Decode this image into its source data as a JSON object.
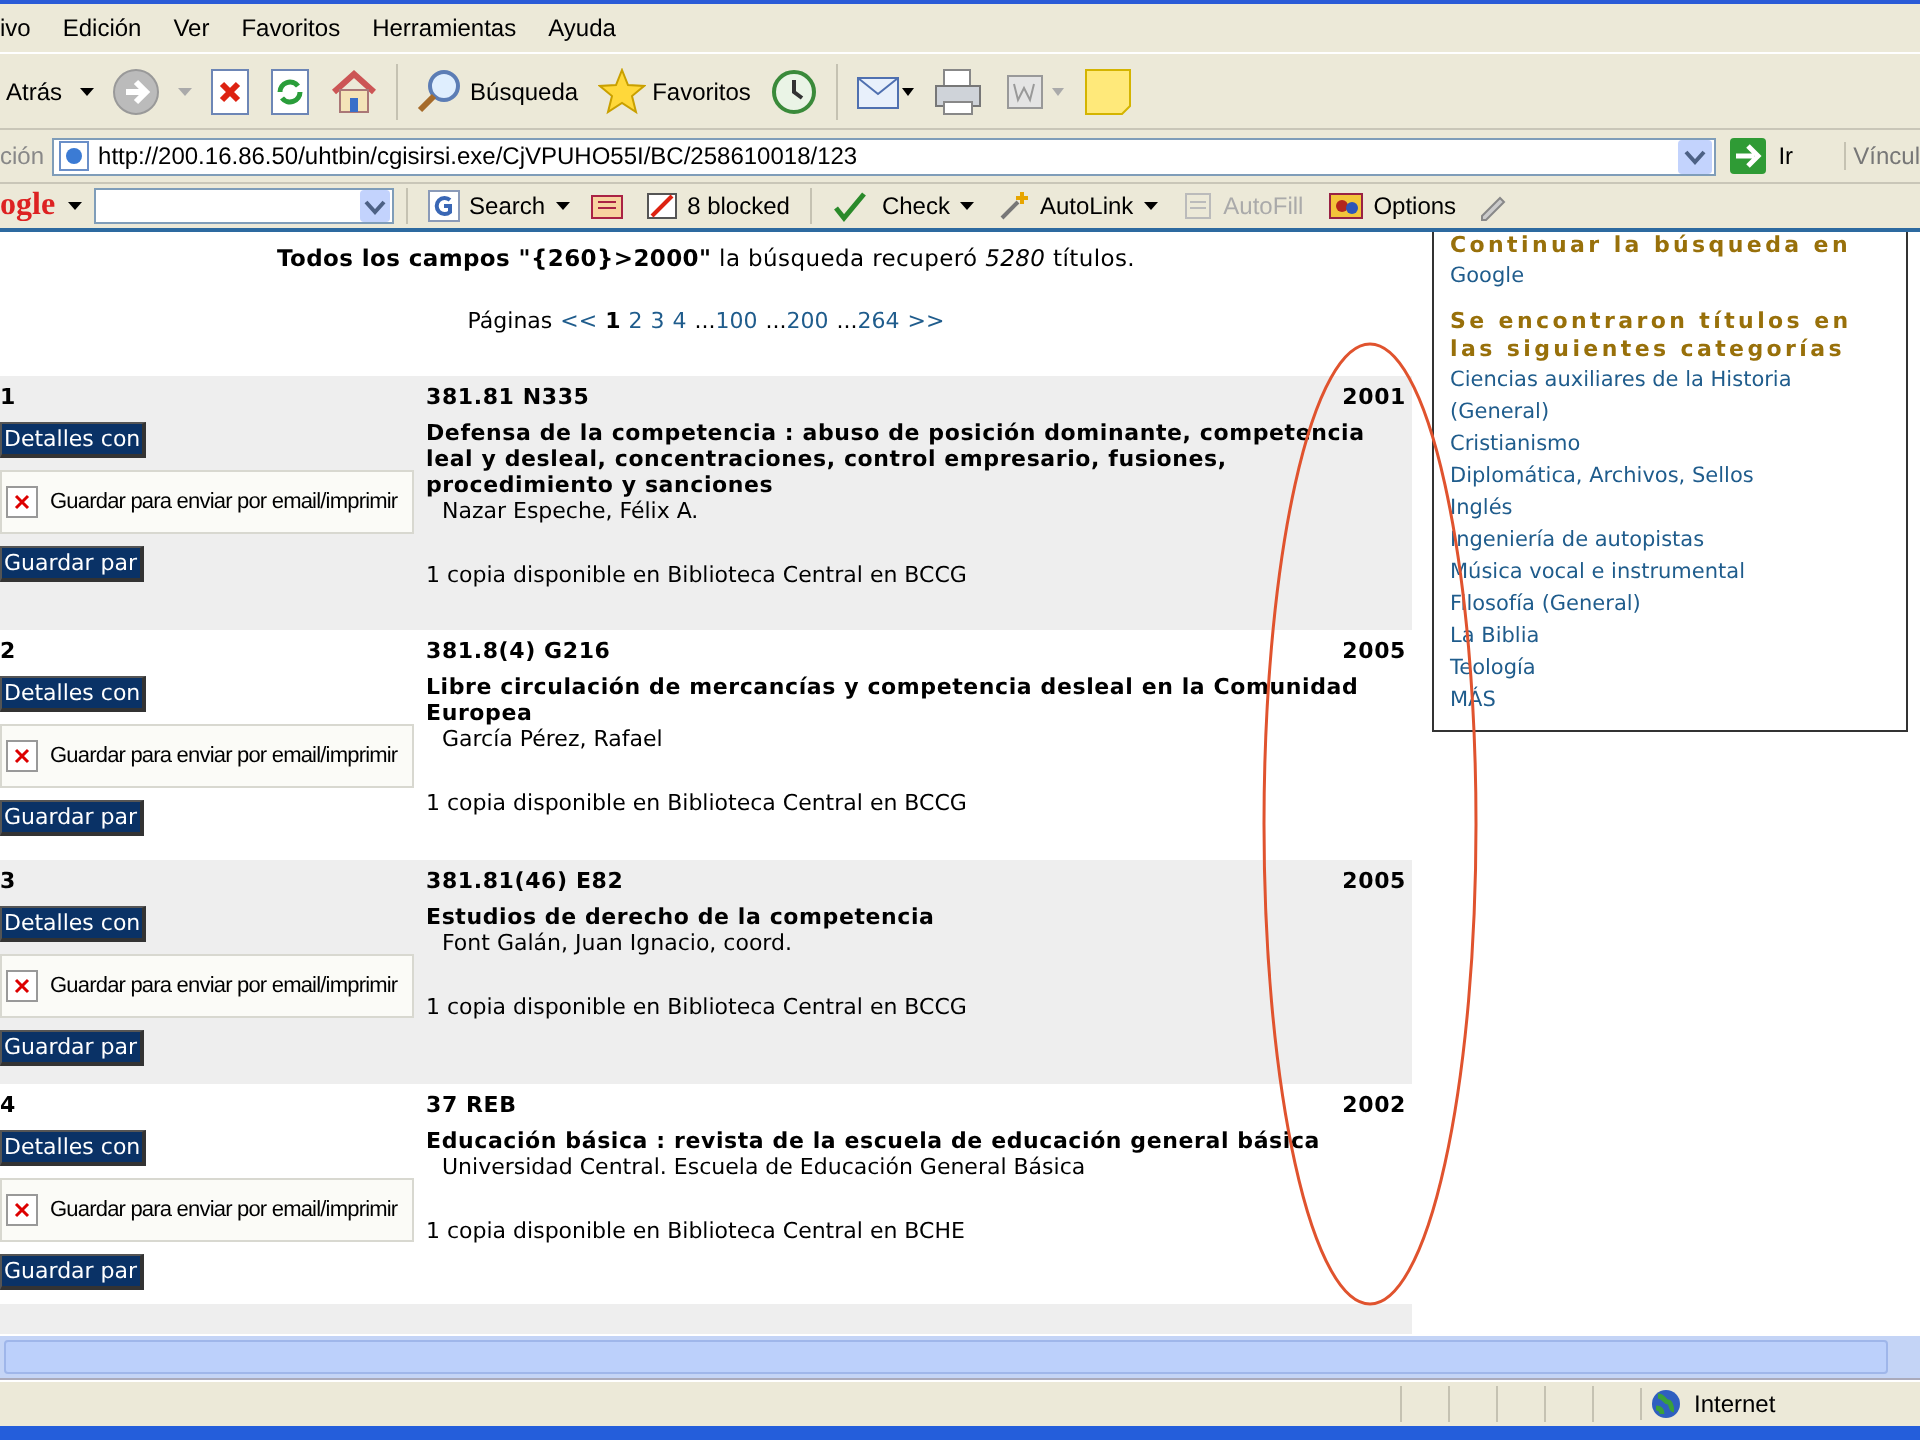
{
  "menu": [
    "ivo",
    "Edición",
    "Ver",
    "Favoritos",
    "Herramientas",
    "Ayuda"
  ],
  "toolbar": {
    "back": "Atrás",
    "search": "Búsqueda",
    "favorites": "Favoritos"
  },
  "address": {
    "label": "ción",
    "url": "http://200.16.86.50/uhtbin/cgisirsi.exe/CjVPUHO55I/BC/258610018/123",
    "go": "Ir",
    "links": "Víncul"
  },
  "google_toolbar": {
    "logo": "ogle",
    "search": "Search",
    "blocked": "8 blocked",
    "check": "Check",
    "autolink": "AutoLink",
    "autofill": "AutoFill",
    "options": "Options"
  },
  "summary": "**Todos los campos \"{260}>2000\"** la búsqueda recuperó *5280* títulos.",
  "pagination": {
    "label": "Páginas",
    "items": [
      {
        "text": "<<",
        "kind": "link"
      },
      {
        "text": "1",
        "kind": "current"
      },
      {
        "text": "2",
        "kind": "link"
      },
      {
        "text": "3",
        "kind": "link"
      },
      {
        "text": "4",
        "kind": "link"
      },
      {
        "text": "...",
        "kind": "gap"
      },
      {
        "text": "100",
        "kind": "link"
      },
      {
        "text": "...",
        "kind": "gap"
      },
      {
        "text": "200",
        "kind": "link"
      },
      {
        "text": "...",
        "kind": "gap"
      },
      {
        "text": "264",
        "kind": "link"
      },
      {
        "text": ">>",
        "kind": "link"
      }
    ]
  },
  "records": [
    {
      "number": "1",
      "call_number": "381.81 N335",
      "year": "2001",
      "details_button": "Detalles con",
      "save_label": "Guardar para enviar por email/imprimir",
      "save_button": "Guardar par",
      "title": "Defensa de la competencia : abuso de posición dominante, competencia leal y desleal, concentraciones, control empresario, fusiones, procedimiento y sanciones",
      "author": "Nazar Espeche, Félix A.",
      "availability": "1 copia disponible en Biblioteca Central en BCCG"
    },
    {
      "number": "2",
      "call_number": "381.8(4) G216",
      "year": "2005",
      "details_button": "Detalles con",
      "save_label": "Guardar para enviar por email/imprimir",
      "save_button": "Guardar par",
      "title": "Libre circulación de mercancías y competencia desleal en la Comunidad Europea",
      "author": "García Pérez, Rafael",
      "availability": "1 copia disponible en Biblioteca Central en BCCG"
    },
    {
      "number": "3",
      "call_number": "381.81(46) E82",
      "year": "2005",
      "details_button": "Detalles con",
      "save_label": "Guardar para enviar por email/imprimir",
      "save_button": "Guardar par",
      "title": "Estudios de derecho de la competencia",
      "author": "Font Galán, Juan Ignacio, coord.",
      "availability": "1 copia disponible en Biblioteca Central en BCCG"
    },
    {
      "number": "4",
      "call_number": "37 REB",
      "year": "2002",
      "details_button": "Detalles con",
      "save_label": "Guardar para enviar por email/imprimir",
      "save_button": "Guardar par",
      "title": "Educación básica : revista de la escuela de educación general básica",
      "author": "Universidad Central. Escuela de Educación General Básica",
      "availability": "1 copia disponible en Biblioteca Central en BCHE"
    }
  ],
  "sidebar": {
    "continue_heading": "Continuar la búsqueda en",
    "continue_links": [
      "Google"
    ],
    "categories_heading": "Se encontraron títulos en las siguientes categorías",
    "categories": [
      "Ciencias auxiliares de la Historia (General)",
      "Cristianismo",
      "Diplomática, Archivos, Sellos",
      "Inglés",
      "Ingeniería de autopistas",
      "Música vocal e instrumental",
      "Filosofía (General)",
      "La Biblia",
      "Teología",
      "MÁS"
    ]
  },
  "status_bar": {
    "zone": "Internet"
  }
}
